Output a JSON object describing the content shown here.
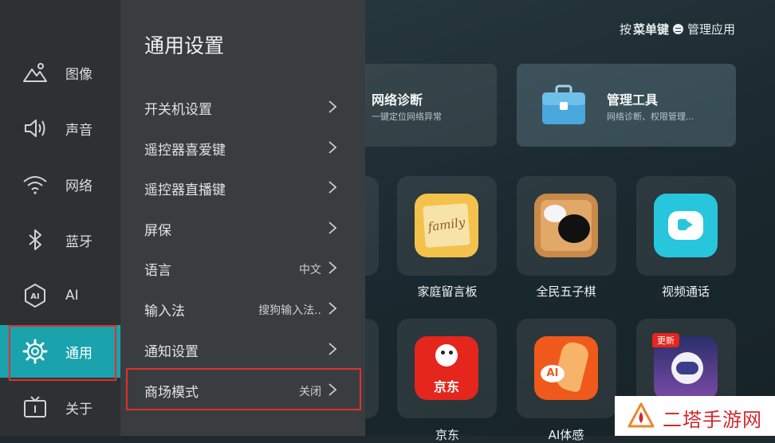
{
  "hint": {
    "prefix": "按",
    "key": "菜单键",
    "suffix": "管理应用"
  },
  "cards": [
    {
      "title": "网络诊断",
      "sub": "一键定位网络异常",
      "icon": "network-diagnosis-icon"
    },
    {
      "title": "管理工具",
      "sub": "网络诊断、权限管理...",
      "icon": "toolbox-icon"
    }
  ],
  "apps": [
    {
      "label": "家庭留言板",
      "icon": "family-board-icon",
      "icon_text": "family"
    },
    {
      "label": "全民五子棋",
      "icon": "gomoku-icon"
    },
    {
      "label": "视频通话",
      "icon": "video-call-icon"
    },
    {
      "label": "京东",
      "icon": "jd-icon",
      "icon_text": "京东"
    },
    {
      "label": "AI体感",
      "icon": "ai-motion-icon",
      "icon_text": "AI"
    },
    {
      "label": "",
      "icon": "astronaut-game-icon",
      "badge": "更新"
    }
  ],
  "rail": {
    "items": [
      {
        "label": "图像",
        "icon": "picture-icon"
      },
      {
        "label": "声音",
        "icon": "speaker-icon"
      },
      {
        "label": "网络",
        "icon": "wifi-icon"
      },
      {
        "label": "蓝牙",
        "icon": "bluetooth-icon"
      },
      {
        "label": "AI",
        "icon": "ai-hexagon-icon"
      },
      {
        "label": "通用",
        "icon": "gear-icon",
        "active": true
      },
      {
        "label": "关于",
        "icon": "tv-info-icon"
      }
    ]
  },
  "panel": {
    "title": "通用设置",
    "rows": [
      {
        "label": "开关机设置",
        "value": ""
      },
      {
        "label": "遥控器喜爱键",
        "value": ""
      },
      {
        "label": "遥控器直播键",
        "value": ""
      },
      {
        "label": "屏保",
        "value": ""
      },
      {
        "label": "语言",
        "value": "中文"
      },
      {
        "label": "输入法",
        "value": "搜狗输入法.."
      },
      {
        "label": "通知设置",
        "value": ""
      },
      {
        "label": "商场模式",
        "value": "关闭"
      }
    ]
  },
  "watermark": {
    "text": "二塔手游网"
  },
  "colors": {
    "accent": "#1aa2ad",
    "highlight_box": "#e0302b",
    "rail_bg": "#2d3134",
    "panel_bg": "#3a3d40"
  }
}
